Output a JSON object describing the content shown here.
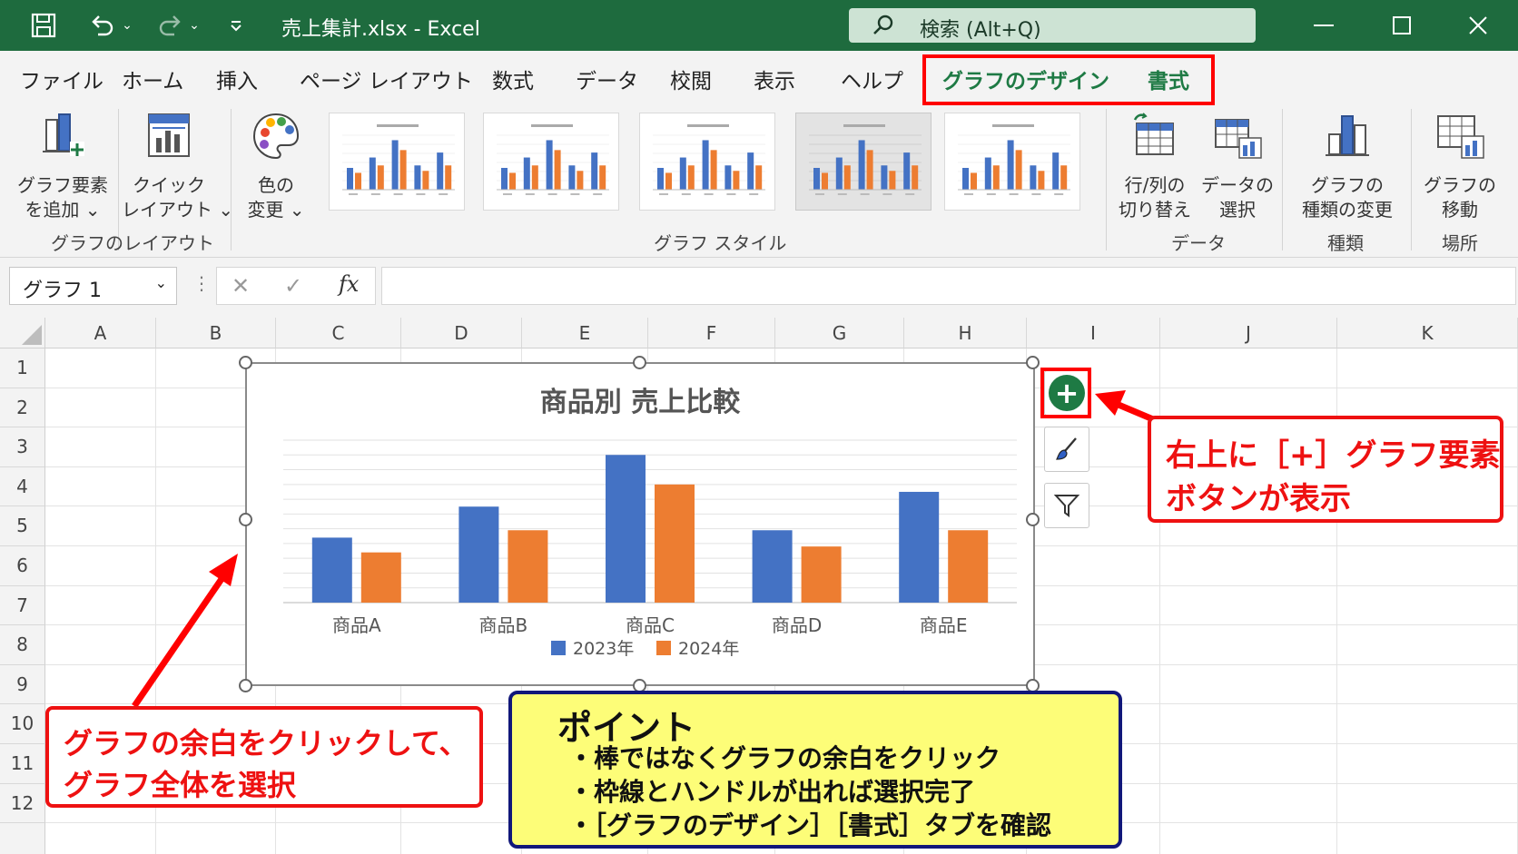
{
  "titlebar": {
    "doc_title": "売上集計.xlsx  -  Excel",
    "search": "検索 (Alt+Q)",
    "icons": [
      "save-icon",
      "undo-icon",
      "redo-icon",
      "customize-qat-icon"
    ]
  },
  "menu": {
    "tabs": [
      "ファイル",
      "ホーム",
      "挿入",
      "ページ レイアウト",
      "数式",
      "データ",
      "校閲",
      "表示",
      "ヘルプ"
    ],
    "context_tabs": [
      "グラフのデザイン",
      "書式"
    ]
  },
  "ribbon": {
    "add_element": [
      "グラフ要素",
      "を追加 ⌄"
    ],
    "quick_layout": [
      "クイック",
      "レイアウト ⌄"
    ],
    "group_layout": "グラフのレイアウト",
    "change_colors": [
      "色の",
      "変更 ⌄"
    ],
    "group_styles": "グラフ スタイル",
    "switch_row_col": [
      "行/列の",
      "切り替え"
    ],
    "select_data": [
      "データの",
      "選択"
    ],
    "group_data": "データ",
    "change_type": [
      "グラフの",
      "種類の変更"
    ],
    "group_type": "種類",
    "move_chart": [
      "グラフの",
      "移動"
    ],
    "group_location": "場所"
  },
  "formula_bar": {
    "name_box": "グラフ 1",
    "cancel": "✕",
    "enter": "✓",
    "fx": "fx",
    "value": ""
  },
  "grid": {
    "columns": [
      "A",
      "B",
      "C",
      "D",
      "E",
      "F",
      "G",
      "H",
      "I",
      "J",
      "K"
    ],
    "rows": [
      "1",
      "2",
      "3",
      "4",
      "5",
      "6",
      "7",
      "8",
      "9",
      "10",
      "11",
      "12"
    ]
  },
  "chart_data": {
    "type": "bar",
    "title": "商品別 売上比較",
    "categories": [
      "商品A",
      "商品B",
      "商品C",
      "商品D",
      "商品E"
    ],
    "series": [
      {
        "name": "2023年",
        "values": [
          44,
          65,
          100,
          49,
          75
        ],
        "color": "#4472c4"
      },
      {
        "name": "2024年",
        "values": [
          34,
          49,
          80,
          38,
          49
        ],
        "color": "#ed7d31"
      }
    ],
    "ylim": [
      0,
      110
    ],
    "grid": true,
    "legend": "bottom"
  },
  "chart_side_buttons": [
    "chart-elements-plus-icon",
    "chart-styles-brush-icon",
    "chart-filters-funnel-icon"
  ],
  "callouts": {
    "plus_button": [
      "右上に［+］グラフ要素",
      "ボタンが表示"
    ],
    "select_chart": [
      "グラフの余白をクリックして、",
      "グラフ全体を選択"
    ]
  },
  "point": {
    "title": "ポイント",
    "items": [
      "・棒ではなくグラフの余白をクリック",
      "・枠線とハンドルが出れば選択完了",
      "・［グラフのデザイン］［書式］タブを確認"
    ]
  },
  "colors": {
    "excel_green": "#1e6b3e",
    "highlight_red": "#ff0000",
    "point_fill": "#fdfd78",
    "point_border": "#11177a"
  }
}
